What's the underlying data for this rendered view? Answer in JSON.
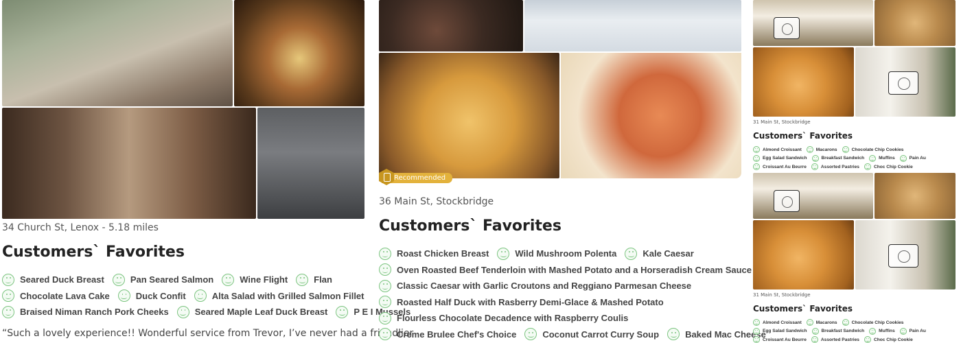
{
  "col1": {
    "photos": [
      "patio-photo",
      "duck-dish-photo",
      "wine-flight-photo",
      "wine-glasses-photo"
    ],
    "address": "34 Church St, Lenox - 5.18 miles",
    "favorites_title": "Customers` Favorites",
    "favorites": [
      [
        "Seared Duck Breast",
        "Pan Seared Salmon",
        "Wine Flight",
        "Flan"
      ],
      [
        "Chocolate Lava Cake",
        "Duck Confit",
        "Alta Salad with Grilled Salmon Fillet"
      ],
      [
        "Braised Niman Ranch Pork Cheeks",
        "Seared Maple Leaf Duck Breast",
        "P E I Mussels"
      ]
    ],
    "review": "“Such a lovely experience!! Wonderful service from Trevor, I’ve never had a friendlier"
  },
  "col2": {
    "badge": "Recommended",
    "address": "36 Main St, Stockbridge",
    "favorites_title": "Customers` Favorites",
    "favorites": [
      [
        "Roast Chicken Breast",
        "Wild Mushroom Polenta",
        "Kale Caesar"
      ],
      [
        "Oven Roasted Beef Tenderloin with Mashed Potato and a Horseradish Cream Sauce"
      ],
      [
        "Classic Caesar with Garlic Croutons and Reggiano Parmesan Cheese"
      ],
      [
        "Roasted Half Duck with Rasberry Demi-Glace & Mashed Potato"
      ],
      [
        "Flourless Chocolate Decadence with Raspberry Coulis"
      ],
      [
        "Creme Brulee Chef's Choice",
        "Coconut Carrot Curry Soup",
        "Baked Mac Cheese"
      ]
    ]
  },
  "col3": {
    "cards": [
      {
        "address": "31 Main St, Stockbridge",
        "favorites_title": "Customers` Favorites",
        "favorites": [
          [
            "Almond Croissant",
            "Macarons",
            "Chocolate Chip Cookies"
          ],
          [
            "Egg Salad Sandwich",
            "Breakfast Sandwich",
            "Muffins",
            "Pain Au"
          ],
          [
            "Croissant Au Beurre",
            "Assorted Pastries",
            "Choc Chip Cookie"
          ]
        ]
      },
      {
        "address": "31 Main St, Stockbridge",
        "favorites_title": "Customers` Favorites",
        "favorites": [
          [
            "Almond Croissant",
            "Macarons",
            "Chocolate Chip Cookies"
          ],
          [
            "Egg Salad Sandwich",
            "Breakfast Sandwich",
            "Muffins",
            "Pain Au"
          ],
          [
            "Croissant Au Beurre",
            "Assorted Pastries",
            "Choc Chip Cookie"
          ]
        ]
      }
    ]
  },
  "colors": {
    "smile_green": "#7bc47f",
    "badge_gold": "#e3b23c"
  }
}
